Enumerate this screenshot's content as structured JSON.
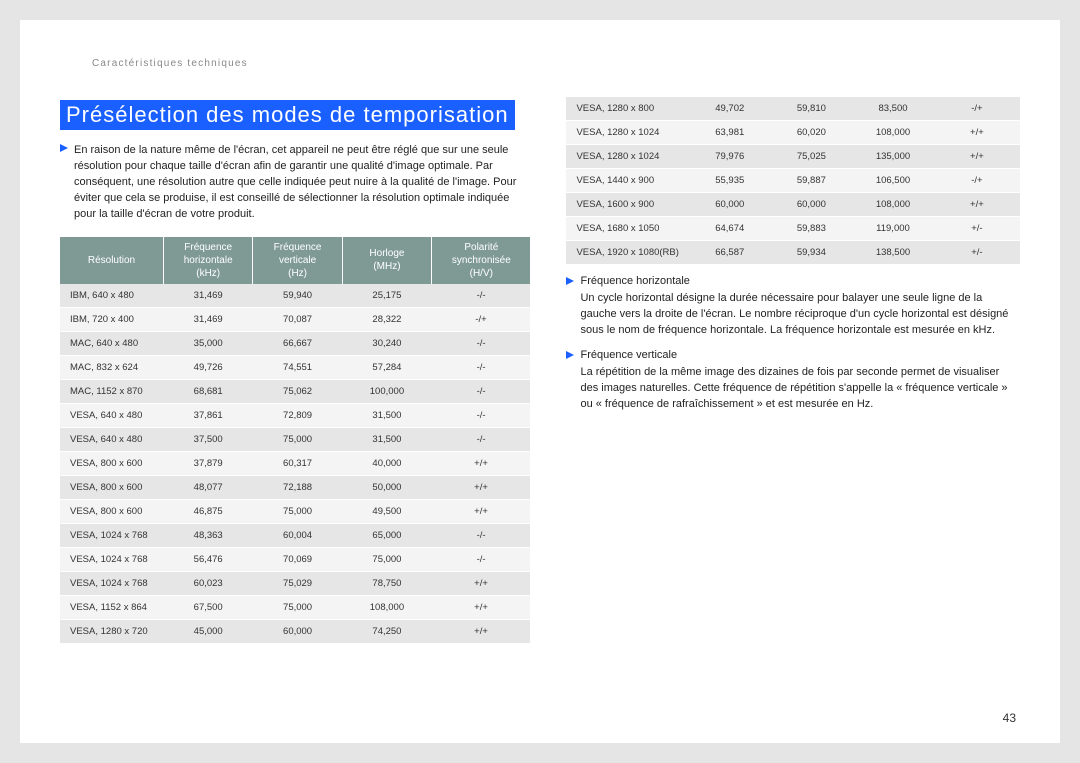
{
  "header": "Caractéristiques techniques",
  "title": "Présélection des modes de temporisation",
  "intro": "En raison de la nature même de l'écran, cet appareil ne peut être réglé que sur une seule résolution pour chaque taille d'écran afin de garantir une qualité d'image optimale. Par conséquent, une résolution autre que celle indiquée peut nuire à la qualité de l'image. Pour éviter que cela se produise, il est conseillé de sélectionner la résolution optimale indiquée pour la taille d'écran de votre produit.",
  "table1": {
    "headers": [
      "Résolution",
      "Fréquence horizontale (kHz)",
      "Fréquence verticale (Hz)",
      "Horloge (MHz)",
      "Polarité synchronisée (H/V)"
    ],
    "rows": [
      [
        "IBM, 640 x 480",
        "31,469",
        "59,940",
        "25,175",
        "-/-"
      ],
      [
        "IBM, 720 x 400",
        "31,469",
        "70,087",
        "28,322",
        "-/+"
      ],
      [
        "MAC, 640 x 480",
        "35,000",
        "66,667",
        "30,240",
        "-/-"
      ],
      [
        "MAC, 832 x 624",
        "49,726",
        "74,551",
        "57,284",
        "-/-"
      ],
      [
        "MAC, 1152 x 870",
        "68,681",
        "75,062",
        "100,000",
        "-/-"
      ],
      [
        "VESA, 640 x 480",
        "37,861",
        "72,809",
        "31,500",
        "-/-"
      ],
      [
        "VESA, 640 x 480",
        "37,500",
        "75,000",
        "31,500",
        "-/-"
      ],
      [
        "VESA, 800 x 600",
        "37,879",
        "60,317",
        "40,000",
        "+/+"
      ],
      [
        "VESA, 800 x 600",
        "48,077",
        "72,188",
        "50,000",
        "+/+"
      ],
      [
        "VESA, 800 x 600",
        "46,875",
        "75,000",
        "49,500",
        "+/+"
      ],
      [
        "VESA, 1024 x 768",
        "48,363",
        "60,004",
        "65,000",
        "-/-"
      ],
      [
        "VESA, 1024 x 768",
        "56,476",
        "70,069",
        "75,000",
        "-/-"
      ],
      [
        "VESA, 1024 x 768",
        "60,023",
        "75,029",
        "78,750",
        "+/+"
      ],
      [
        "VESA, 1152 x 864",
        "67,500",
        "75,000",
        "108,000",
        "+/+"
      ],
      [
        "VESA, 1280 x 720",
        "45,000",
        "60,000",
        "74,250",
        "+/+"
      ]
    ]
  },
  "table2": {
    "rows": [
      [
        "VESA, 1280 x 800",
        "49,702",
        "59,810",
        "83,500",
        "-/+"
      ],
      [
        "VESA, 1280 x 1024",
        "63,981",
        "60,020",
        "108,000",
        "+/+"
      ],
      [
        "VESA, 1280 x 1024",
        "79,976",
        "75,025",
        "135,000",
        "+/+"
      ],
      [
        "VESA, 1440 x 900",
        "55,935",
        "59,887",
        "106,500",
        "-/+"
      ],
      [
        "VESA, 1600 x 900",
        "60,000",
        "60,000",
        "108,000",
        "+/+"
      ],
      [
        "VESA, 1680 x 1050",
        "64,674",
        "59,883",
        "119,000",
        "+/-"
      ],
      [
        "VESA, 1920 x 1080(RB)",
        "66,587",
        "59,934",
        "138,500",
        "+/-"
      ]
    ]
  },
  "freq_h_title": "Fréquence horizontale",
  "freq_h_text": "Un cycle horizontal désigne la durée nécessaire pour balayer une seule ligne de la gauche vers la droite de l'écran. Le nombre réciproque d'un cycle horizontal est désigné sous le nom de fréquence horizontale. La fréquence horizontale est mesurée en kHz.",
  "freq_v_title": "Fréquence verticale",
  "freq_v_text": "La répétition de la même image des dizaines de fois par seconde permet de visualiser des images naturelles. Cette fréquence de répétition s'appelle la « fréquence verticale » ou « fréquence de rafraîchissement » et est mesurée en Hz.",
  "page_number": "43"
}
